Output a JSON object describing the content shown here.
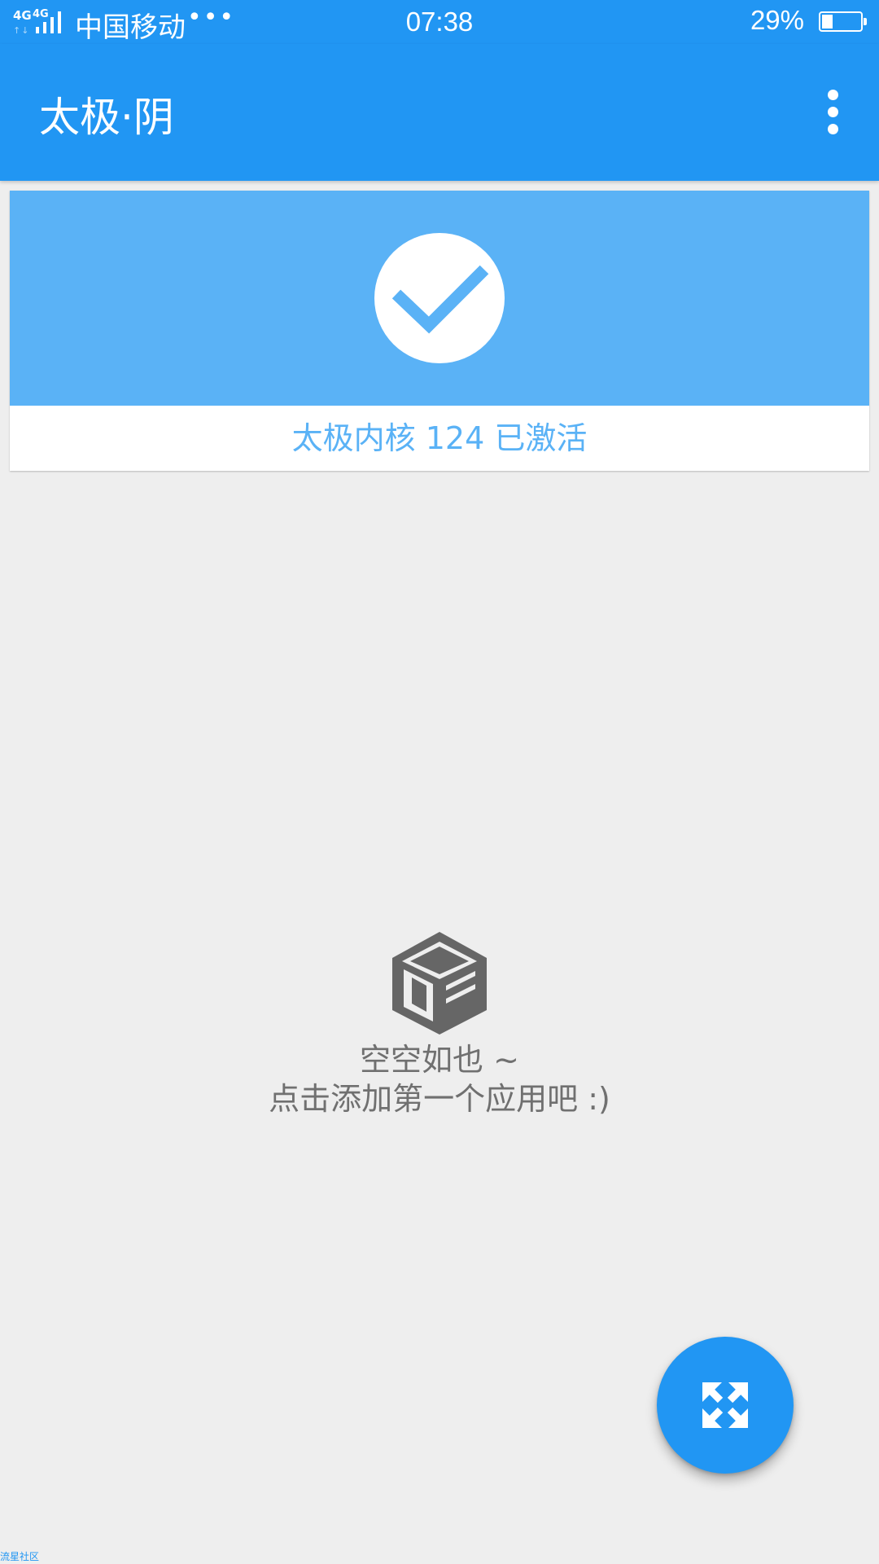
{
  "status_bar": {
    "network_1": "4G",
    "network_2": "4G",
    "network_arrows": "↑↓",
    "carrier": "中国移动",
    "more_indicator": "•••",
    "time": "07:38",
    "battery_percent": "29%",
    "battery_level": 0.29
  },
  "app_bar": {
    "title": "太极·阴",
    "overflow_icon": "more-vert-icon"
  },
  "status_card": {
    "icon": "check-icon",
    "label": "太极内核 124 已激活"
  },
  "empty_state": {
    "icon": "box-icon",
    "title": "空空如也 ~",
    "subtitle": "点击添加第一个应用吧 :)"
  },
  "fab": {
    "icon": "expand-arrows-icon"
  },
  "watermark": "流星社区",
  "colors": {
    "primary": "#2196f3",
    "banner": "#5ab2f6",
    "background": "#eeeeee",
    "empty_text": "#707070",
    "empty_icon": "#666666"
  }
}
